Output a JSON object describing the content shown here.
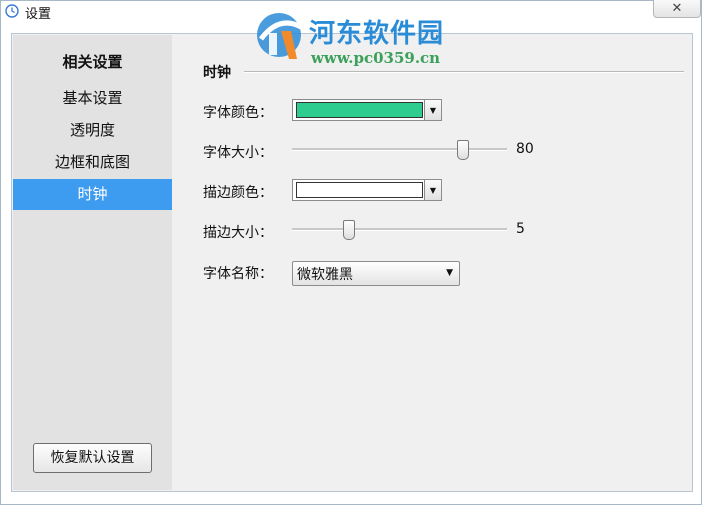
{
  "window": {
    "title": "设置",
    "close_symbol": "✕"
  },
  "watermark": {
    "name": "河东软件园",
    "url": "www.pc0359.cn"
  },
  "sidebar": {
    "header": "相关设置",
    "items": [
      {
        "label": "基本设置",
        "active": false
      },
      {
        "label": "透明度",
        "active": false
      },
      {
        "label": "边框和底图",
        "active": false
      },
      {
        "label": "时钟",
        "active": true
      }
    ],
    "restore_label": "恢复默认设置"
  },
  "panel": {
    "title": "时钟",
    "font_color": {
      "label": "字体颜色：",
      "value": "#2ecc8e"
    },
    "font_size": {
      "label": "字体大小：",
      "value": "80",
      "level": 0.79
    },
    "stroke_color": {
      "label": "描边颜色：",
      "value": "#ffffff"
    },
    "stroke_size": {
      "label": "描边大小：",
      "value": "5",
      "level": 0.26
    },
    "font_name": {
      "label": "字体名称：",
      "value": "微软雅黑"
    }
  },
  "colors": {
    "accent": "#3d9bf0",
    "sidebar_bg": "#e2e2e2",
    "panel_bg": "#f0f0f0"
  }
}
